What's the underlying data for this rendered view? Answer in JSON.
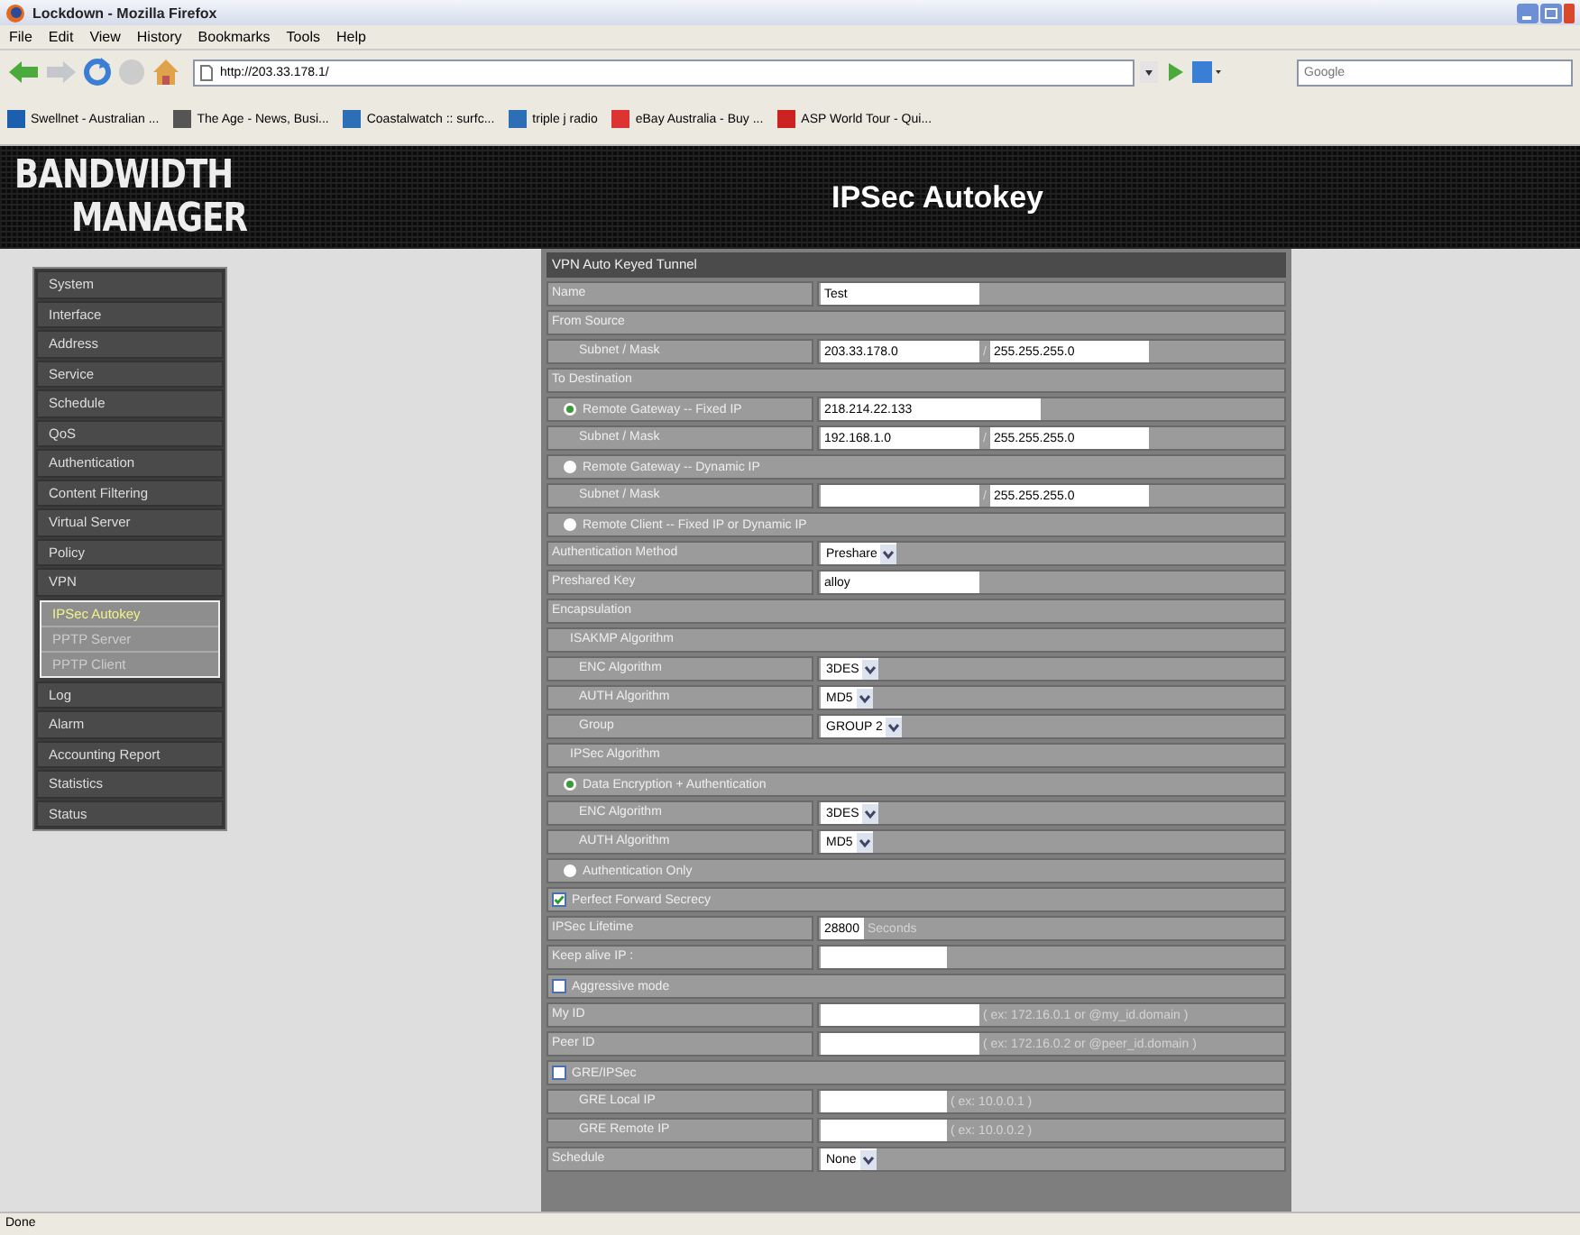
{
  "window": {
    "title": "Lockdown - Mozilla Firefox"
  },
  "menu": [
    "File",
    "Edit",
    "View",
    "History",
    "Bookmarks",
    "Tools",
    "Help"
  ],
  "address_bar": {
    "value": "http://203.33.178.1/"
  },
  "search": {
    "placeholder": "Google"
  },
  "bookmarks": [
    "Swellnet - Australian ...",
    "The Age - News, Busi...",
    "Coastalwatch :: surfc...",
    "triple j radio",
    "eBay Australia - Buy ...",
    "ASP World Tour - Qui..."
  ],
  "banner": {
    "logo_top": "BANDWIDTH",
    "logo_bottom": "MANAGER",
    "title": "IPSec Autokey"
  },
  "sidebar": {
    "items": [
      {
        "label": "System",
        "selected": false
      },
      {
        "label": "Interface",
        "selected": false
      },
      {
        "label": "Address",
        "selected": false
      },
      {
        "label": "Service",
        "selected": false
      },
      {
        "label": "Schedule",
        "selected": false
      },
      {
        "label": "QoS",
        "selected": false
      },
      {
        "label": "Authentication",
        "selected": false
      },
      {
        "label": "Content Filtering",
        "selected": false
      },
      {
        "label": "Virtual Server",
        "selected": false
      },
      {
        "label": "Policy",
        "selected": false
      },
      {
        "label": "VPN",
        "selected": false,
        "expanded": true,
        "children": [
          {
            "label": "IPSec Autokey",
            "selected": true
          },
          {
            "label": "PPTP Server",
            "selected": false
          },
          {
            "label": "PPTP Client",
            "selected": false
          }
        ]
      },
      {
        "label": "Log",
        "selected": false
      },
      {
        "label": "Alarm",
        "selected": false
      },
      {
        "label": "Accounting Report",
        "selected": false
      },
      {
        "label": "Statistics",
        "selected": false
      },
      {
        "label": "Status",
        "selected": false
      }
    ]
  },
  "form": {
    "rows": [
      {
        "kind": "header",
        "label": "VPN Auto Keyed Tunnel"
      },
      {
        "kind": "field",
        "label": "Name",
        "indented": false,
        "controls": [
          {
            "kind": "input",
            "value": "Test"
          }
        ]
      },
      {
        "kind": "section",
        "label": "From Source",
        "indented": false
      },
      {
        "kind": "field",
        "label": "Subnet / Mask",
        "indented": true,
        "controls": [
          {
            "kind": "input",
            "value": "203.33.178.0"
          },
          {
            "kind": "text",
            "text": "/"
          },
          {
            "kind": "input",
            "value": "255.255.255.0"
          }
        ]
      },
      {
        "kind": "section",
        "label": "To Destination",
        "indented": false
      },
      {
        "kind": "radio",
        "label": "Remote Gateway -- Fixed IP",
        "selected": true,
        "controls": [
          {
            "kind": "input",
            "value": "218.214.22.133"
          }
        ]
      },
      {
        "kind": "field",
        "label": "Subnet / Mask",
        "indented": true,
        "controls": [
          {
            "kind": "input",
            "value": "192.168.1.0"
          },
          {
            "kind": "text",
            "text": "/"
          },
          {
            "kind": "input",
            "value": "255.255.255.0"
          }
        ]
      },
      {
        "kind": "radio",
        "label": "Remote Gateway -- Dynamic IP",
        "selected": false
      },
      {
        "kind": "field",
        "label": "Subnet / Mask",
        "indented": true,
        "controls": [
          {
            "kind": "input"
          },
          {
            "kind": "text",
            "text": "/"
          },
          {
            "kind": "input",
            "value": "255.255.255.0"
          }
        ]
      },
      {
        "kind": "radio",
        "label": "Remote Client -- Fixed IP or Dynamic IP",
        "selected": false
      },
      {
        "kind": "field",
        "label": "Authentication Method",
        "indented": false,
        "controls": [
          {
            "kind": "select",
            "value": "Preshare"
          }
        ]
      },
      {
        "kind": "field",
        "label": "Preshared Key",
        "indented": false,
        "controls": [
          {
            "kind": "input",
            "value": "alloy"
          }
        ]
      },
      {
        "kind": "section",
        "label": "Encapsulation",
        "indented": false
      },
      {
        "kind": "section",
        "label": "ISAKMP Algorithm",
        "indented": true
      },
      {
        "kind": "field",
        "label": "ENC Algorithm",
        "indented": true,
        "controls": [
          {
            "kind": "select",
            "value": "3DES"
          }
        ]
      },
      {
        "kind": "field",
        "label": "AUTH Algorithm",
        "indented": true,
        "controls": [
          {
            "kind": "select",
            "value": "MD5"
          }
        ]
      },
      {
        "kind": "field",
        "label": "Group",
        "indented": true,
        "controls": [
          {
            "kind": "select",
            "value": "GROUP 2"
          }
        ]
      },
      {
        "kind": "section",
        "label": "IPSec Algorithm",
        "indented": true
      },
      {
        "kind": "radio",
        "label": "Data Encryption + Authentication",
        "selected": true
      },
      {
        "kind": "field",
        "label": "ENC Algorithm",
        "indented": true,
        "controls": [
          {
            "kind": "select",
            "value": "3DES"
          }
        ]
      },
      {
        "kind": "field",
        "label": "AUTH Algorithm",
        "indented": true,
        "controls": [
          {
            "kind": "select",
            "value": "MD5"
          }
        ]
      },
      {
        "kind": "radio",
        "label": "Authentication Only",
        "selected": false
      },
      {
        "kind": "checkbox",
        "label": "Perfect Forward Secrecy",
        "checked": true
      },
      {
        "kind": "field",
        "label": "IPSec Lifetime",
        "indented": false,
        "controls": [
          {
            "kind": "input",
            "value": "28800"
          },
          {
            "kind": "text",
            "text": "Seconds"
          }
        ]
      },
      {
        "kind": "field",
        "label": "Keep alive IP :",
        "indented": false,
        "controls": [
          {
            "kind": "input"
          }
        ]
      },
      {
        "kind": "checkbox",
        "label": "Aggressive mode",
        "checked": false
      },
      {
        "kind": "field",
        "label": "My ID",
        "indented": false,
        "controls": [
          {
            "kind": "input"
          },
          {
            "kind": "text",
            "text": "( ex: 172.16.0.1 or @my_id.domain )"
          }
        ]
      },
      {
        "kind": "field",
        "label": "Peer ID",
        "indented": false,
        "controls": [
          {
            "kind": "input"
          },
          {
            "kind": "text",
            "text": "( ex: 172.16.0.2 or @peer_id.domain )"
          }
        ]
      },
      {
        "kind": "checkbox",
        "label": "GRE/IPSec",
        "checked": false
      },
      {
        "kind": "field",
        "label": "GRE Local IP",
        "indented": true,
        "controls": [
          {
            "kind": "input"
          },
          {
            "kind": "text",
            "text": "( ex: 10.0.0.1 )"
          }
        ]
      },
      {
        "kind": "field",
        "label": "GRE Remote IP",
        "indented": true,
        "controls": [
          {
            "kind": "input"
          },
          {
            "kind": "text",
            "text": "( ex: 10.0.0.2 )"
          }
        ]
      },
      {
        "kind": "field",
        "label": "Schedule",
        "indented": false,
        "controls": [
          {
            "kind": "select",
            "value": "None"
          }
        ]
      }
    ]
  },
  "status_bar": {
    "text": "Done"
  }
}
